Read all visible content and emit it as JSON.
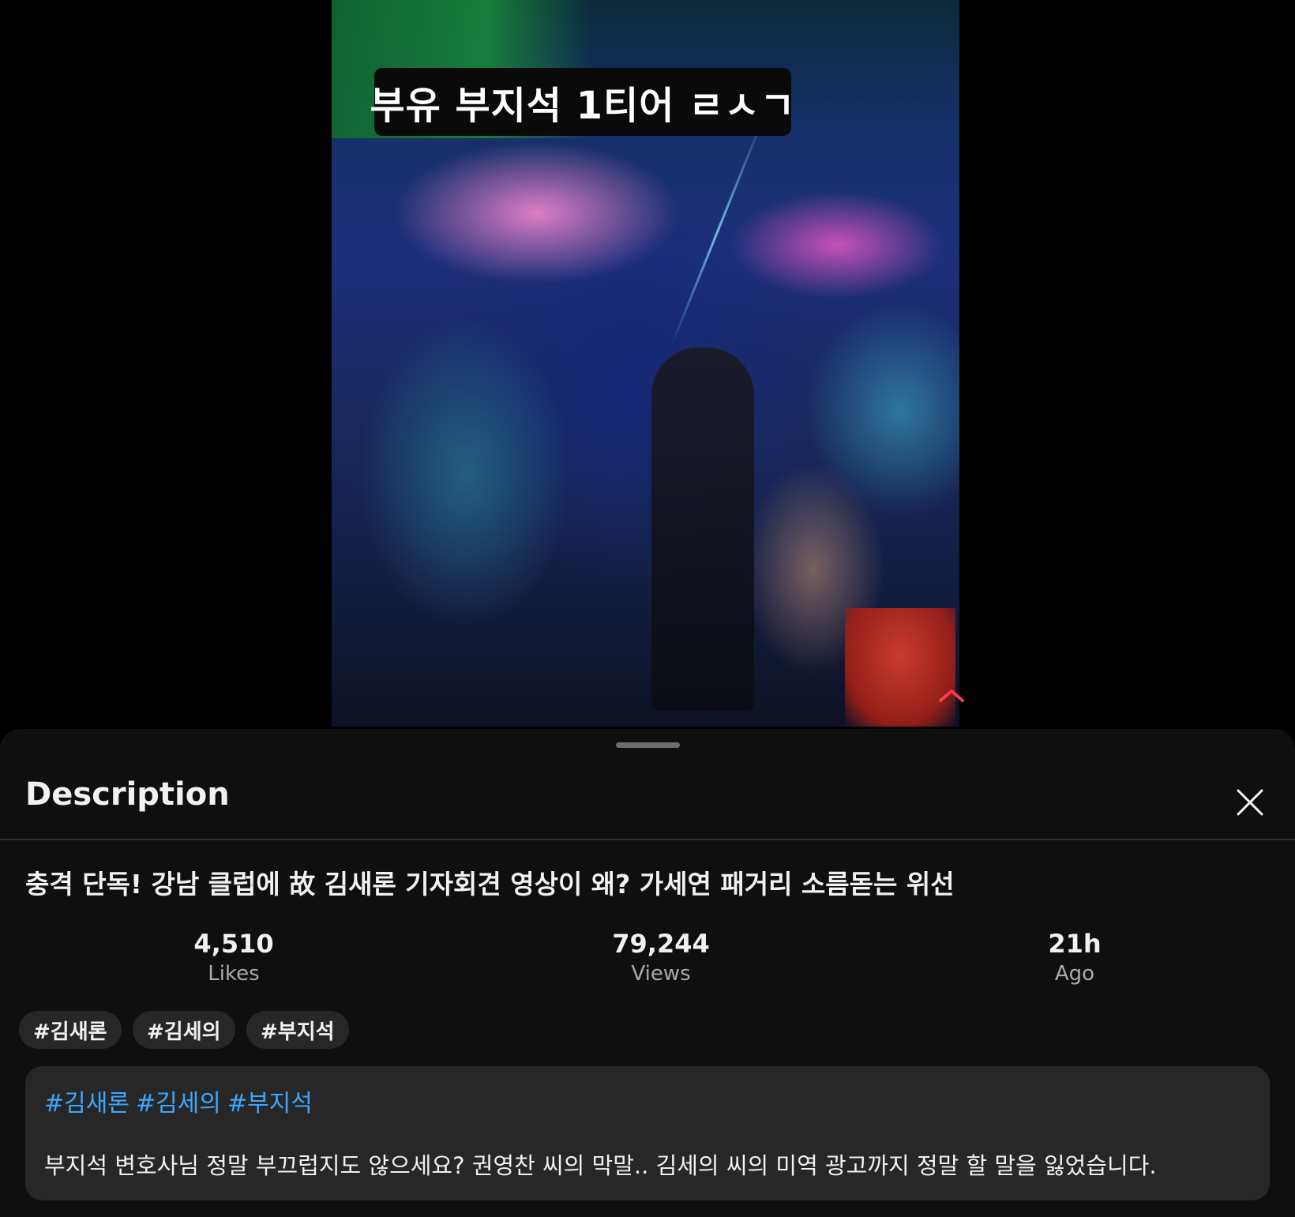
{
  "video": {
    "caption": "부유 부지석 1티어 ㄹㅅㄱ",
    "progress_fraction": 0.012
  },
  "sheet": {
    "title": "Description",
    "video_title": "충격 단독! 강남 클럽에 故 김새론 기자회견 영상이 왜? 가세연 패거리 소름돋는 위선",
    "stats": {
      "likes": {
        "value": "4,510",
        "label": "Likes"
      },
      "views": {
        "value": "79,244",
        "label": "Views"
      },
      "ago": {
        "value": "21h",
        "label": "Ago"
      }
    },
    "chips": [
      "#김새론",
      "#김세의",
      "#부지석"
    ],
    "description": {
      "tags": [
        "#김새론",
        "#김세의",
        "#부지석"
      ],
      "text": "부지석 변호사님 정말 부끄럽지도 않으세요? 권영찬 씨의 막말.. 김세의 씨의 미역 광고까지 정말 할 말을 잃었습니다."
    }
  },
  "icons": {
    "close": "close-icon",
    "expand": "chevron-up-icon"
  },
  "colors": {
    "sheet_bg": "#0f0f0f",
    "chip_bg": "#272727",
    "link": "#3ea6ff",
    "chevron": "#ff3b4e"
  }
}
